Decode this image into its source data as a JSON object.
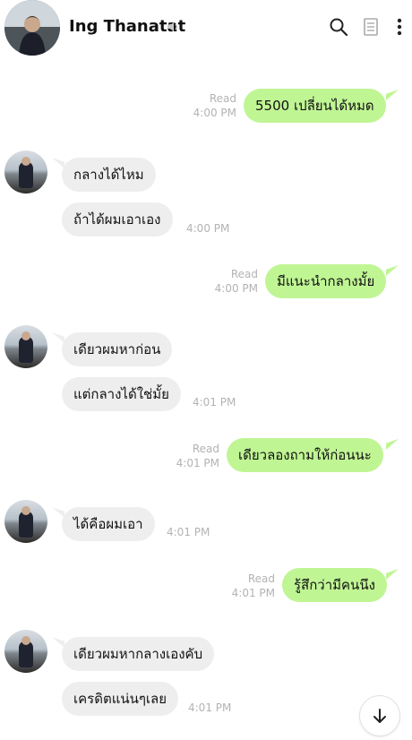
{
  "header": {
    "contact_name": "Ing Thanatat",
    "icons": [
      "speaker-icon",
      "search-icon",
      "notes-icon",
      "more-icon"
    ]
  },
  "messages": [
    {
      "dir": "out",
      "text": "5500 เปลี่ยนได้หมด",
      "read": "Read",
      "time": "4:00 PM"
    },
    {
      "dir": "in",
      "text": "กลางได้ไหม"
    },
    {
      "dir": "in",
      "text": "ถ้าได้ผมเอาเอง",
      "time": "4:00 PM"
    },
    {
      "dir": "out",
      "text": "มีแนะนำกลางมั้ย",
      "read": "Read",
      "time": "4:00 PM"
    },
    {
      "dir": "in",
      "text": "เดียวผมหาก่อน"
    },
    {
      "dir": "in",
      "text": "แต่กลางได้ใช่มั้ย",
      "time": "4:01 PM"
    },
    {
      "dir": "out",
      "text": "เดียวลองถามให้ก่อนนะ",
      "read": "Read",
      "time": "4:01 PM"
    },
    {
      "dir": "in",
      "text": "ได้คือผมเอา",
      "time": "4:01 PM"
    },
    {
      "dir": "out",
      "text": "รู้สึกว่ามีคนนึง",
      "read": "Read",
      "time": "4:01 PM"
    },
    {
      "dir": "in",
      "text": "เดียวผมหากลางเองคับ"
    },
    {
      "dir": "in",
      "text": "เครดิตแน่นๆเลย",
      "time": "4:01 PM"
    }
  ],
  "colors": {
    "outgoing_bubble": "#c0f594",
    "incoming_bubble": "#eeeeee",
    "meta_text": "#b3b3b3"
  }
}
